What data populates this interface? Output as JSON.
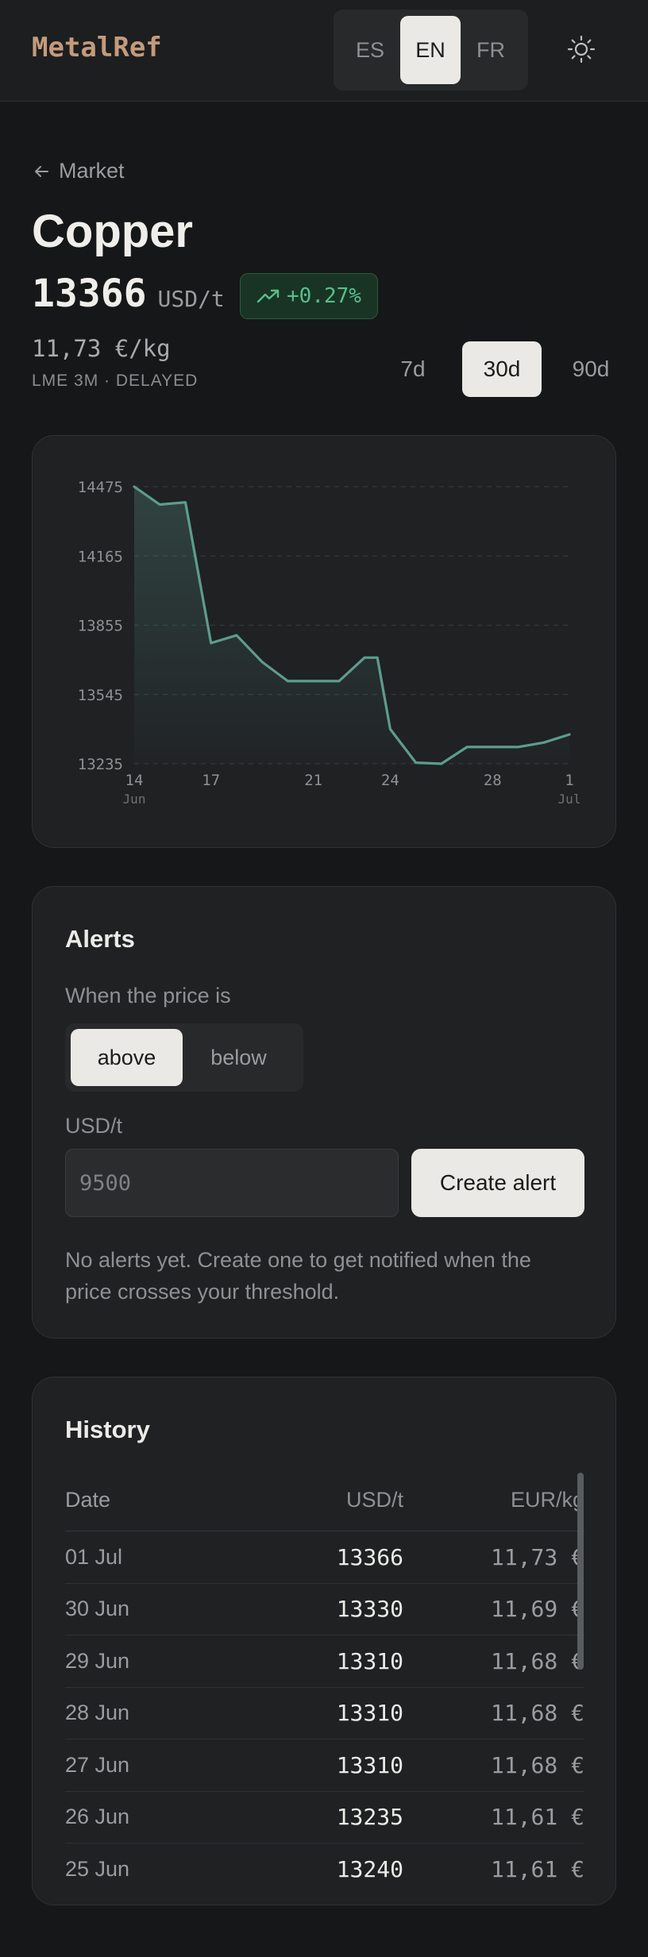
{
  "app": {
    "brand": "MetalRef"
  },
  "languages": [
    {
      "label": "ES",
      "active": false
    },
    {
      "label": "EN",
      "active": true
    },
    {
      "label": "FR",
      "active": false
    }
  ],
  "nav": {
    "back_label": "Market"
  },
  "metal": {
    "name": "Copper",
    "price": "13366",
    "unit": "USD/t",
    "change": "+0.27%",
    "eur_price": "11,73 €/kg",
    "source": "LME 3M · DELAYED"
  },
  "ranges": [
    {
      "label": "7d",
      "active": false
    },
    {
      "label": "30d",
      "active": true
    },
    {
      "label": "90d",
      "active": false
    }
  ],
  "chart_data": {
    "type": "area",
    "x": [
      "14 Jun",
      "15 Jun",
      "16 Jun",
      "17 Jun",
      "18 Jun",
      "19 Jun",
      "20 Jun",
      "21 Jun",
      "22 Jun",
      "23 Jun",
      "23.5 Jun",
      "24 Jun",
      "25 Jun",
      "26 Jun",
      "27 Jun",
      "28 Jun",
      "29 Jun",
      "30 Jun",
      "01 Jul"
    ],
    "values": [
      14475,
      14395,
      14405,
      13775,
      13810,
      13690,
      13605,
      13605,
      13605,
      13710,
      13710,
      13390,
      13240,
      13235,
      13310,
      13310,
      13310,
      13330,
      13366
    ],
    "yticks": [
      "14475",
      "14165",
      "13855",
      "13545",
      "13235"
    ],
    "ytick_values": [
      14475,
      14165,
      13855,
      13545,
      13235
    ],
    "xticks": [
      {
        "label": "14",
        "sub": "Jun",
        "x": 0
      },
      {
        "label": "17",
        "sub": "",
        "x": 3
      },
      {
        "label": "21",
        "sub": "",
        "x": 7
      },
      {
        "label": "24",
        "sub": "",
        "x": 10
      },
      {
        "label": "28",
        "sub": "",
        "x": 14
      },
      {
        "label": "1",
        "sub": "Jul",
        "x": 17
      }
    ],
    "ylim": [
      13235,
      14475
    ],
    "grid": true,
    "line_color": "#5d9c8e"
  },
  "alerts": {
    "title": "Alerts",
    "condition_label": "When the price is",
    "options": [
      {
        "label": "above",
        "active": true
      },
      {
        "label": "below",
        "active": false
      }
    ],
    "unit_label": "USD/t",
    "input_placeholder": "9500",
    "input_value": "",
    "create_label": "Create alert",
    "empty_message": "No alerts yet. Create one to get notified when the price crosses your threshold."
  },
  "history": {
    "title": "History",
    "columns": [
      "Date",
      "USD/t",
      "EUR/kg"
    ],
    "rows": [
      {
        "date": "01 Jul",
        "usd": "13366",
        "eur": "11,73 €"
      },
      {
        "date": "30 Jun",
        "usd": "13330",
        "eur": "11,69 €"
      },
      {
        "date": "29 Jun",
        "usd": "13310",
        "eur": "11,68 €"
      },
      {
        "date": "28 Jun",
        "usd": "13310",
        "eur": "11,68 €"
      },
      {
        "date": "27 Jun",
        "usd": "13310",
        "eur": "11,68 €"
      },
      {
        "date": "26 Jun",
        "usd": "13235",
        "eur": "11,61 €"
      },
      {
        "date": "25 Jun",
        "usd": "13240",
        "eur": "11,61 €"
      }
    ]
  }
}
